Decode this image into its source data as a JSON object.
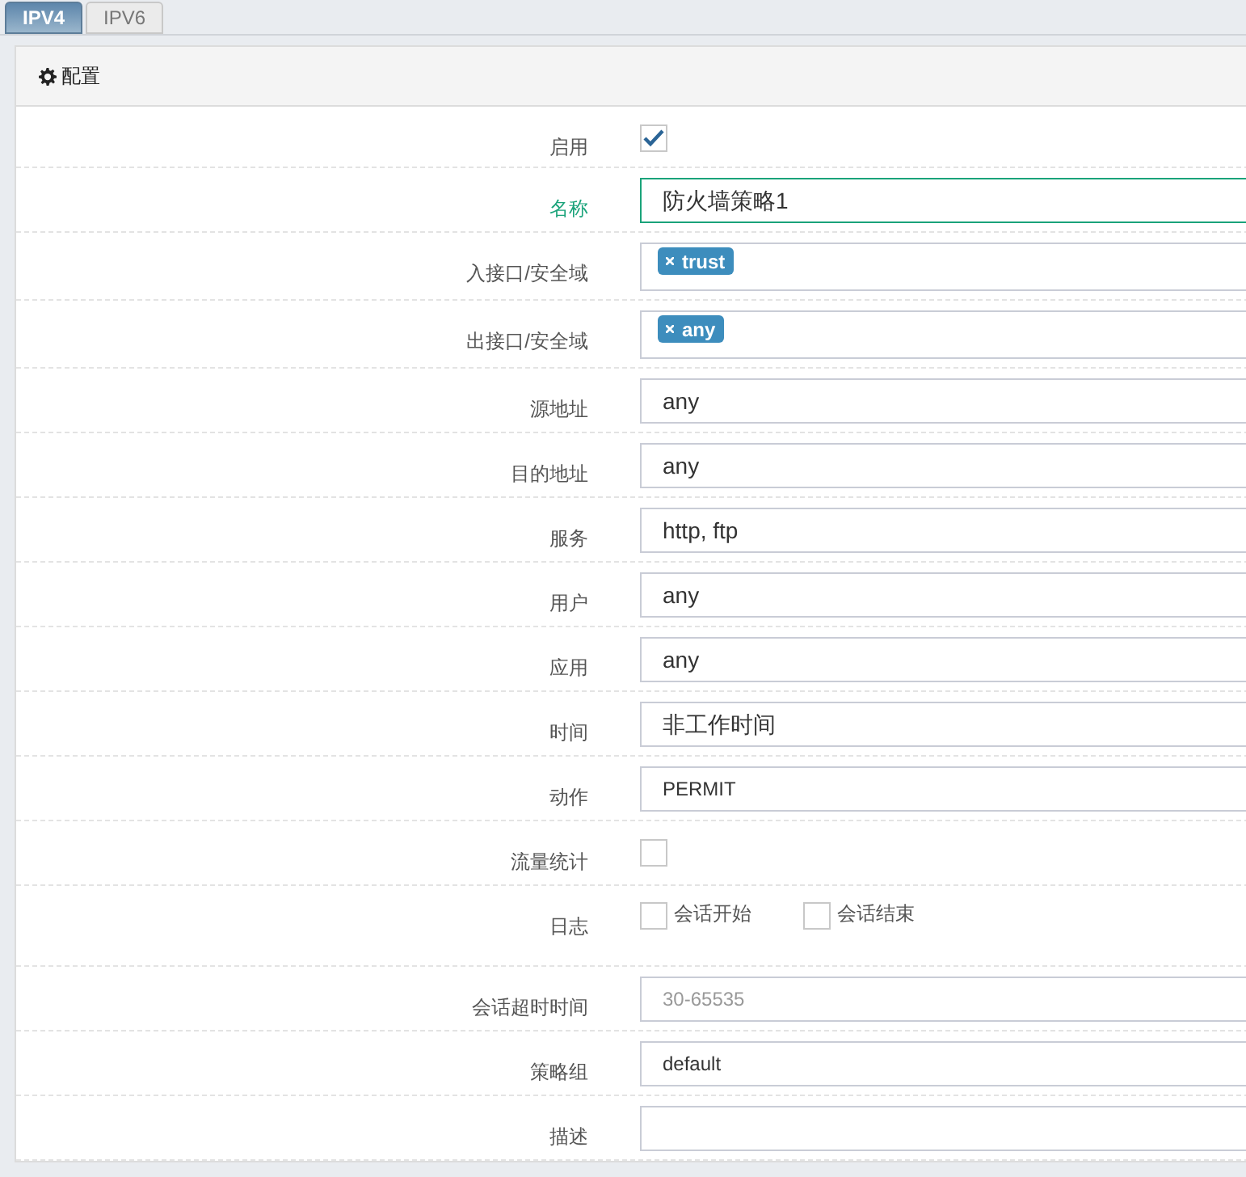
{
  "tabs": [
    {
      "label": "IPV4",
      "selected": true
    },
    {
      "label": "IPV6",
      "selected": false
    }
  ],
  "panel": {
    "title": "配置"
  },
  "fields": [
    {
      "kind": "checkbox",
      "label": "启用",
      "checked": true
    },
    {
      "kind": "text",
      "label": "名称",
      "value": "防火墙策略1",
      "focused": true
    },
    {
      "kind": "tags",
      "label": "入接口/安全域",
      "tags": [
        "trust"
      ]
    },
    {
      "kind": "tags",
      "label": "出接口/安全域",
      "tags": [
        "any"
      ]
    },
    {
      "kind": "text",
      "label": "源地址",
      "value": "any",
      "focused": false
    },
    {
      "kind": "text",
      "label": "目的地址",
      "value": "any",
      "focused": false
    },
    {
      "kind": "text",
      "label": "服务",
      "value": "http, ftp",
      "focused": false
    },
    {
      "kind": "text",
      "label": "用户",
      "value": "any",
      "focused": false
    },
    {
      "kind": "text",
      "label": "应用",
      "value": "any",
      "focused": false
    },
    {
      "kind": "text",
      "label": "时间",
      "value": "非工作时间",
      "focused": false
    },
    {
      "kind": "text",
      "label": "动作",
      "value": "PERMIT",
      "focused": false,
      "small": true
    },
    {
      "kind": "checkbox",
      "label": "流量统计",
      "checked": false
    },
    {
      "kind": "checks",
      "label": "日志",
      "options": [
        {
          "label": "会话开始",
          "checked": false
        },
        {
          "label": "会话结束",
          "checked": false
        }
      ]
    },
    {
      "kind": "placeholder",
      "label": "会话超时时间",
      "placeholder": "30-65535"
    },
    {
      "kind": "text",
      "label": "策略组",
      "value": "default",
      "focused": false,
      "small": true
    },
    {
      "kind": "text",
      "label": "描述",
      "focused": false
    }
  ]
}
